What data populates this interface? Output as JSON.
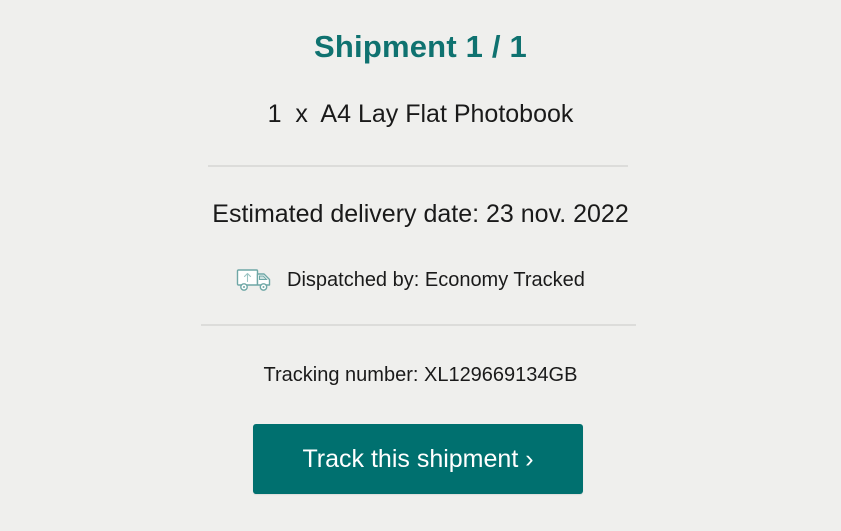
{
  "shipment": {
    "title": "Shipment 1 / 1",
    "product": "1  x  A4 Lay Flat Photobook",
    "estimated_delivery": "Estimated delivery date: 23 nov. 2022",
    "dispatch": {
      "icon": "delivery-truck-icon",
      "text": "Dispatched by: Economy Tracked"
    },
    "tracking_number": "Tracking number: XL129669134GB",
    "track_button_label": "Track this shipment ›"
  },
  "colors": {
    "accent": "#0f7270",
    "button": "#00706f",
    "background": "#efefed",
    "divider": "#dcdcda"
  }
}
